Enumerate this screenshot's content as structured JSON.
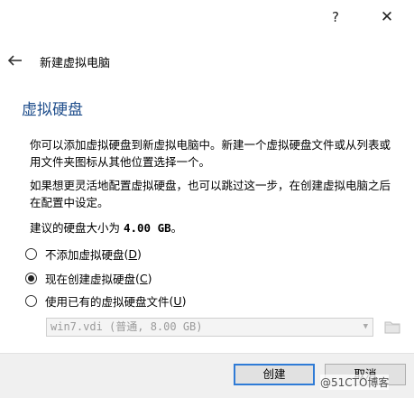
{
  "window": {
    "help_label": "?",
    "close_label": "✕"
  },
  "header": {
    "title": "新建虚拟电脑"
  },
  "page": {
    "heading": "虚拟硬盘",
    "paragraph1": "你可以添加虚拟硬盘到新虚拟电脑中。新建一个虚拟硬盘文件或从列表或用文件夹图标从其他位置选择一个。",
    "paragraph2": "如果想更灵活地配置虚拟硬盘，也可以跳过这一步，在创建虚拟电脑之后在配置中设定。",
    "size_prefix": "建议的硬盘大小为 ",
    "size_value": "4.00 GB",
    "size_suffix": "。"
  },
  "options": [
    {
      "label": "不添加虚拟硬盘",
      "shortcut": "D",
      "checked": false
    },
    {
      "label": "现在创建虚拟硬盘",
      "shortcut": "C",
      "checked": true
    },
    {
      "label": "使用已有的虚拟硬盘文件",
      "shortcut": "U",
      "checked": false
    }
  ],
  "file_select": {
    "value": "win7.vdi (普通, 8.00 GB)",
    "enabled": false
  },
  "buttons": {
    "create": "创建",
    "cancel": "取消"
  },
  "watermark": "@51CTO博客",
  "icons": {
    "back": "arrow-left-icon",
    "folder": "folder-icon",
    "dropdown": "chevron-down-icon"
  }
}
